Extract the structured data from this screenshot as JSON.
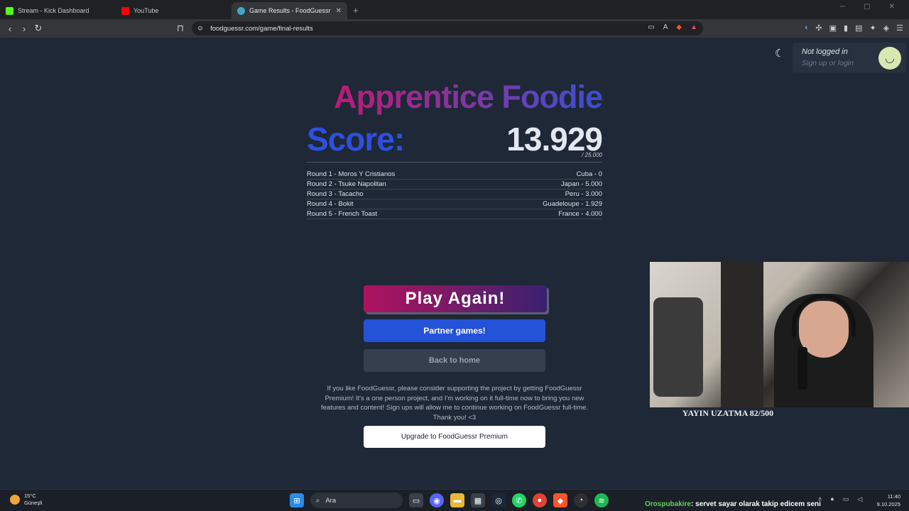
{
  "browser": {
    "tabs": [
      {
        "title": "Stream - Kick Dashboard",
        "active": false,
        "favicon_color": "#53fc18"
      },
      {
        "title": "YouTube",
        "active": false,
        "favicon_color": "#ff0000"
      },
      {
        "title": "Game Results - FoodGuessr | Fo",
        "active": true,
        "favicon_color": "#3fa9c4"
      }
    ],
    "new_tab": "+",
    "url": "foodguessr.com/game/final-results"
  },
  "account": {
    "status": "Not logged in",
    "action": "Sign up or login"
  },
  "results": {
    "rank_title": "Apprentice Foodie",
    "score_label": "Score:",
    "score_value": "13.929",
    "score_max": "/ 25.000",
    "rounds": [
      {
        "left": "Round 1 - Moros Y Cristianos",
        "right": "Cuba - 0"
      },
      {
        "left": "Round 2 - Tsuke Napolitan",
        "right": "Japan - 5.000"
      },
      {
        "left": "Round 3 - Tacacho",
        "right": "Peru - 3.000"
      },
      {
        "left": "Round 4 - Bokit",
        "right": "Guadeloupe - 1.929"
      },
      {
        "left": "Round 5 - French Toast",
        "right": "France - 4.000"
      }
    ]
  },
  "actions": {
    "play_again": "Play Again!",
    "partner_games": "Partner games!",
    "back_home": "Back to home",
    "support_text": "If you like FoodGuessr, please consider supporting the project by getting FoodGuessr Premium! It's a one person project, and I'm working on it full-time now to bring you new features and content! Sign ups will allow me to continue working on FoodGuessr full-time. Thank you! <3",
    "upgrade": "Upgrade to FoodGuessr Premium"
  },
  "stream_overlay": {
    "caption": "YAYIN UZATMA 82/500",
    "chat_user": "Orospubakire",
    "chat_message": ": servet sayar olarak takip edicem seni"
  },
  "taskbar": {
    "temperature": "15°C",
    "condition": "Güneşli",
    "search": "Ara",
    "time": "11:40",
    "date": "9.10.2025"
  },
  "colors": {
    "background": "#1e2836",
    "score_blue": "#2f4fe0",
    "partner_button": "#2452d8",
    "home_button": "#353f4e"
  }
}
